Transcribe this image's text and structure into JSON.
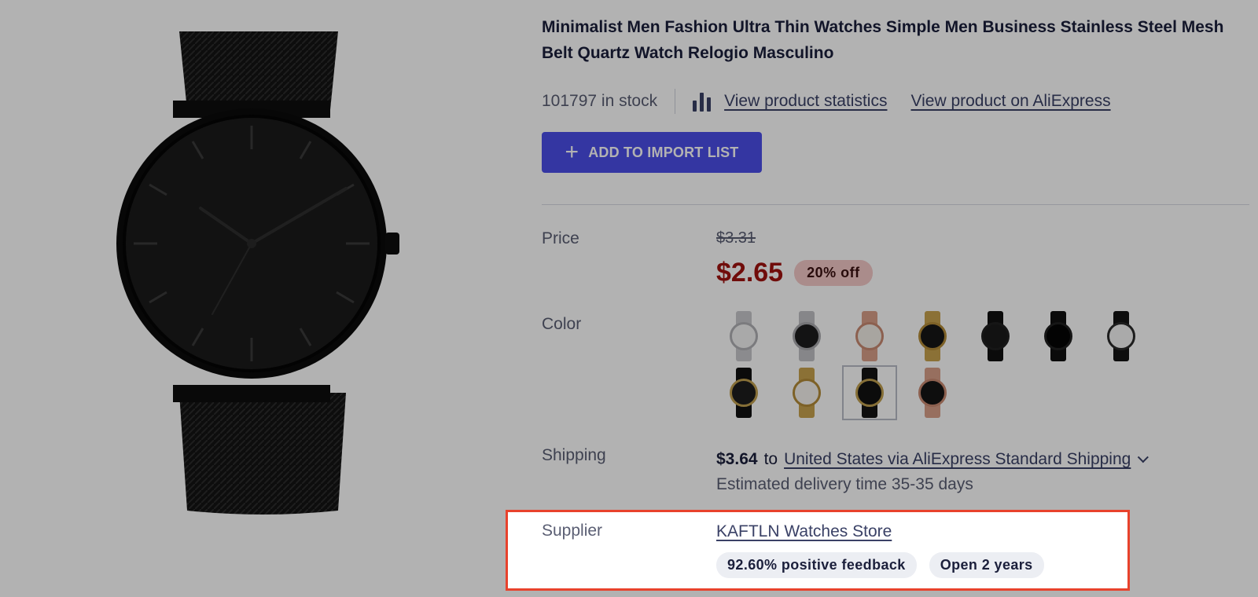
{
  "product": {
    "title": "Minimalist Men Fashion Ultra Thin Watches Simple Men Business Stainless Steel Mesh Belt Quartz Watch Relogio Masculino",
    "stock_text": "101797 in stock",
    "stats_link": "View product statistics",
    "aliexpress_link": "View product on AliExpress",
    "import_button": "ADD TO IMPORT LIST"
  },
  "price": {
    "label": "Price",
    "old": "$3.31",
    "new": "$2.65",
    "discount": "20% off"
  },
  "color": {
    "label": "Color",
    "swatches": [
      {
        "strap": "#c8c8cc",
        "face": "#f2f2f2",
        "bezel": "#b0b0b5"
      },
      {
        "strap": "#c0c0c4",
        "face": "#1c1c1e",
        "bezel": "#a8a8ad"
      },
      {
        "strap": "#d9a089",
        "face": "#f1ece6",
        "bezel": "#c98a72"
      },
      {
        "strap": "#c8a24e",
        "face": "#161616",
        "bezel": "#b38c38"
      },
      {
        "strap": "#111111",
        "face": "#1a1a1a",
        "bezel": "#202020"
      },
      {
        "strap": "#111111",
        "face": "#050505",
        "bezel": "#202020"
      },
      {
        "strap": "#141414",
        "face": "#f4f4f4",
        "bezel": "#2a2a2a"
      },
      {
        "strap": "#111111",
        "face": "#1e1e1e",
        "bezel": "#c0a050"
      },
      {
        "strap": "#c8a24e",
        "face": "#f5f3ee",
        "bezel": "#b38c38"
      },
      {
        "strap": "#141414",
        "face": "#121212",
        "bezel": "#c0a050",
        "selected": true
      },
      {
        "strap": "#d9a089",
        "face": "#151515",
        "bezel": "#c98a72"
      }
    ]
  },
  "shipping": {
    "label": "Shipping",
    "price": "$3.64",
    "to": "to",
    "method_link": "United States via AliExpress Standard Shipping",
    "delivery": "Estimated delivery time 35-35 days"
  },
  "supplier": {
    "label": "Supplier",
    "store_link": "KAFTLN Watches Store",
    "feedback": "92.60% positive feedback",
    "open": "Open 2 years"
  },
  "colors": {
    "accent": "#4b4ee8",
    "sale_price": "#a1120f",
    "highlight_border": "#e8422c"
  }
}
